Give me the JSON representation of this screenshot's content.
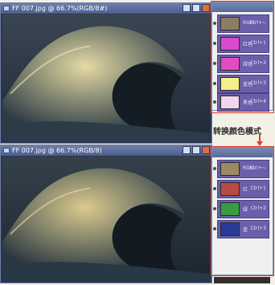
{
  "top_window": {
    "title": "FF 007.jpg @ 66.7%(RGB/8#)",
    "channels": [
      {
        "label": "RGB",
        "shortcut": "Ctrl+~",
        "thumb_color": "#8b7f63"
      },
      {
        "label": "红色",
        "shortcut": "Ctrl+1",
        "thumb_color": "#d94ad0"
      },
      {
        "label": "绿色",
        "shortcut": "Ctrl+2",
        "thumb_color": "#e24bc3"
      },
      {
        "label": "蓝色",
        "shortcut": "Ctrl+3",
        "thumb_color": "#f6ee8a"
      },
      {
        "label": "黑色",
        "shortcut": "Ctrl+4",
        "thumb_color": "#efd6ef"
      }
    ]
  },
  "caption": "转换颜色模式",
  "bottom_window": {
    "title": "FF 007.jpg @ 66.7%(RGB/8)",
    "channels": [
      {
        "label": "RGB",
        "shortcut": "Ctrl+~",
        "thumb_color": "#9a8a63"
      },
      {
        "label": "红",
        "shortcut": "Ctrl+1",
        "thumb_color": "#b94a42"
      },
      {
        "label": "绿",
        "shortcut": "Ctrl+2",
        "thumb_color": "#3a9b45"
      },
      {
        "label": "蓝",
        "shortcut": "Ctrl+3",
        "thumb_color": "#2a3a9b"
      }
    ]
  },
  "colors": {
    "accent_red": "#e83a2a",
    "panel_purple": "#6a5fa8"
  }
}
